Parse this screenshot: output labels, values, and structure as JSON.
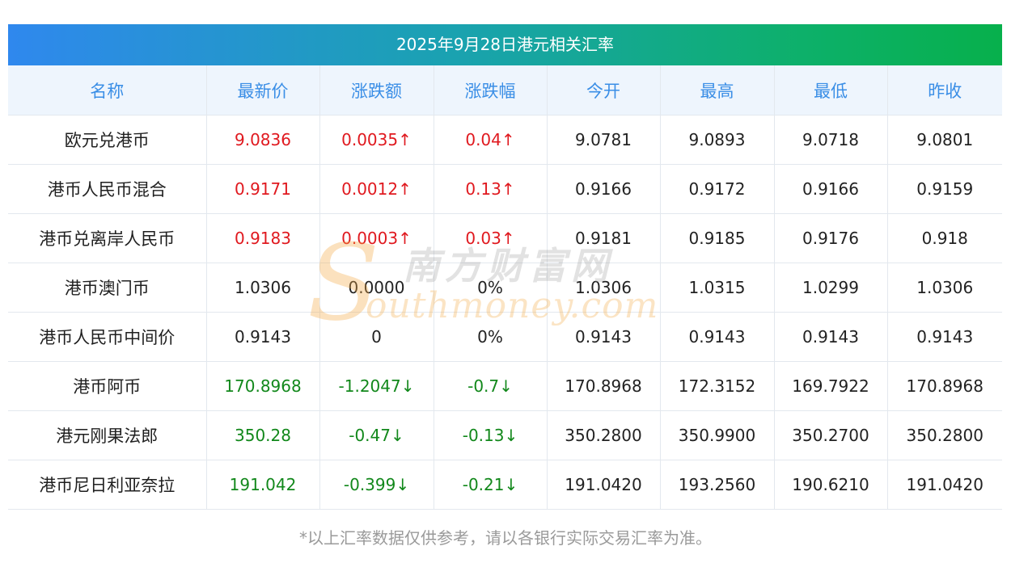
{
  "title": "2025年9月28日港元相关汇率",
  "columns": [
    "名称",
    "最新价",
    "涨跌额",
    "涨跌幅",
    "今开",
    "最高",
    "最低",
    "昨收"
  ],
  "rows": [
    {
      "name": "欧元兑港币",
      "latest": "9.0836",
      "change": "0.0035↑",
      "pct": "0.04↑",
      "open": "9.0781",
      "high": "9.0893",
      "low": "9.0718",
      "prev": "9.0801",
      "trend": "up"
    },
    {
      "name": "港币人民币混合",
      "latest": "0.9171",
      "change": "0.0012↑",
      "pct": "0.13↑",
      "open": "0.9166",
      "high": "0.9172",
      "low": "0.9166",
      "prev": "0.9159",
      "trend": "up"
    },
    {
      "name": "港币兑离岸人民币",
      "latest": "0.9183",
      "change": "0.0003↑",
      "pct": "0.03↑",
      "open": "0.9181",
      "high": "0.9185",
      "low": "0.9176",
      "prev": "0.918",
      "trend": "up"
    },
    {
      "name": "港币澳门币",
      "latest": "1.0306",
      "change": "0.0000",
      "pct": "0%",
      "open": "1.0306",
      "high": "1.0315",
      "low": "1.0299",
      "prev": "1.0306",
      "trend": "flat"
    },
    {
      "name": "港币人民币中间价",
      "latest": "0.9143",
      "change": "0",
      "pct": "0%",
      "open": "0.9143",
      "high": "0.9143",
      "low": "0.9143",
      "prev": "0.9143",
      "trend": "flat"
    },
    {
      "name": "港币阿币",
      "latest": "170.8968",
      "change": "-1.2047↓",
      "pct": "-0.7↓",
      "open": "170.8968",
      "high": "172.3152",
      "low": "169.7922",
      "prev": "170.8968",
      "trend": "down"
    },
    {
      "name": "港元刚果法郎",
      "latest": "350.28",
      "change": "-0.47↓",
      "pct": "-0.13↓",
      "open": "350.2800",
      "high": "350.9900",
      "low": "350.2700",
      "prev": "350.2800",
      "trend": "down"
    },
    {
      "name": "港币尼日利亚奈拉",
      "latest": "191.042",
      "change": "-0.399↓",
      "pct": "-0.21↓",
      "open": "191.0420",
      "high": "193.2560",
      "low": "190.6210",
      "prev": "191.0420",
      "trend": "down"
    }
  ],
  "watermark": {
    "cn": "南方财富网",
    "s": "S",
    "en": "outhmoney.com"
  },
  "footnote": "*以上汇率数据仅供参考，请以各银行实际交易汇率为准。",
  "colors": {
    "up": "#e0191f",
    "down": "#12881b",
    "header_text": "#3a8ee6",
    "header_bg": "#eef5fd"
  }
}
